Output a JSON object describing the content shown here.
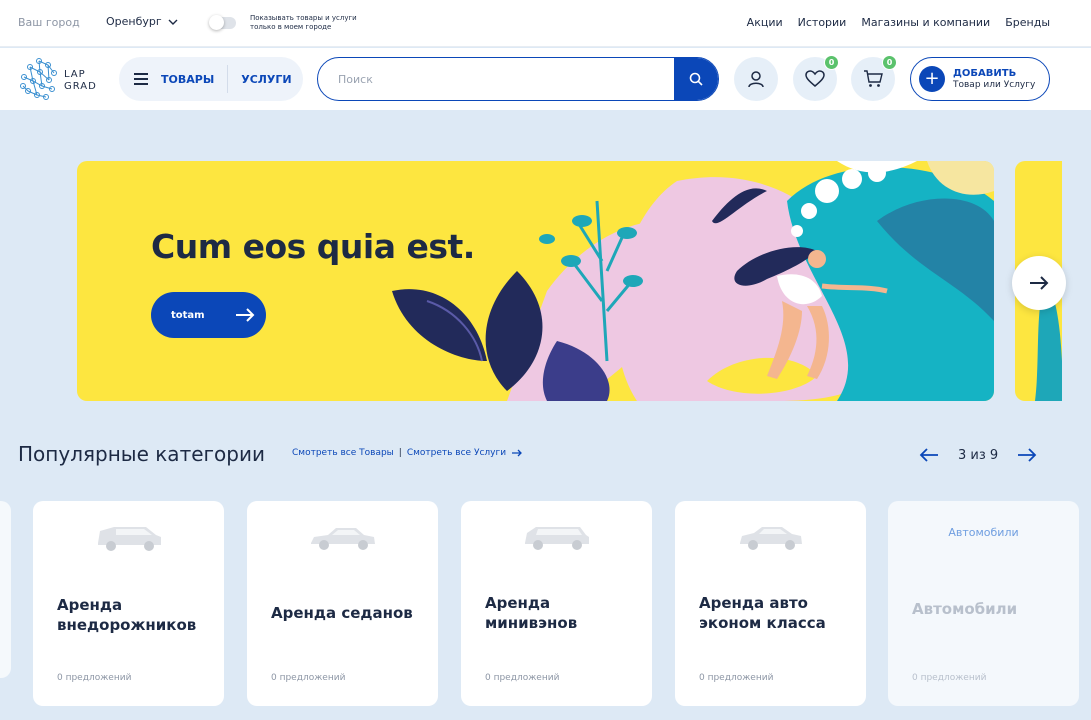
{
  "topbar": {
    "city_label": "Ваш город",
    "city_value": "Оренбург",
    "local_toggle_text": "Показывать товары и услуги только в моем городе",
    "nav": [
      "Акции",
      "Истории",
      "Магазины и компании",
      "Бренды"
    ]
  },
  "header": {
    "logo_text_line1": "LAP",
    "logo_text_line2": "GRAD",
    "goods_label": "ТОВАРЫ",
    "services_label": "УСЛУГИ",
    "search_placeholder": "Поиск",
    "favorites_count": "0",
    "cart_count": "0",
    "add_title": "ДОБАВИТЬ",
    "add_subtitle": "Товар или Услугу"
  },
  "banner": {
    "title": "Cum eos quia est.",
    "button_label": "totam"
  },
  "categories": {
    "title": "Популярные категории",
    "link_goods": "Смотреть все Товары",
    "link_separator": "|",
    "link_services": "Смотреть все Услуги",
    "pager_text": "3 из 9",
    "cards": [
      {
        "title": "Аренда внедорожников",
        "count": "0 предложений"
      },
      {
        "title": "Аренда седанов",
        "count": "0 предложений"
      },
      {
        "title": "Аренда минивэнов",
        "count": "0 предложений"
      },
      {
        "title": "Аренда авто эконом класса",
        "count": "0 предложений"
      },
      {
        "tag": "Автомобили",
        "title": "Автомобили",
        "count": "0 предложений"
      }
    ]
  },
  "colors": {
    "brand_blue": "#0b47b8",
    "banner_yellow": "#fde640",
    "badge_green": "#5bc26c",
    "page_bg": "#dde9f5"
  }
}
